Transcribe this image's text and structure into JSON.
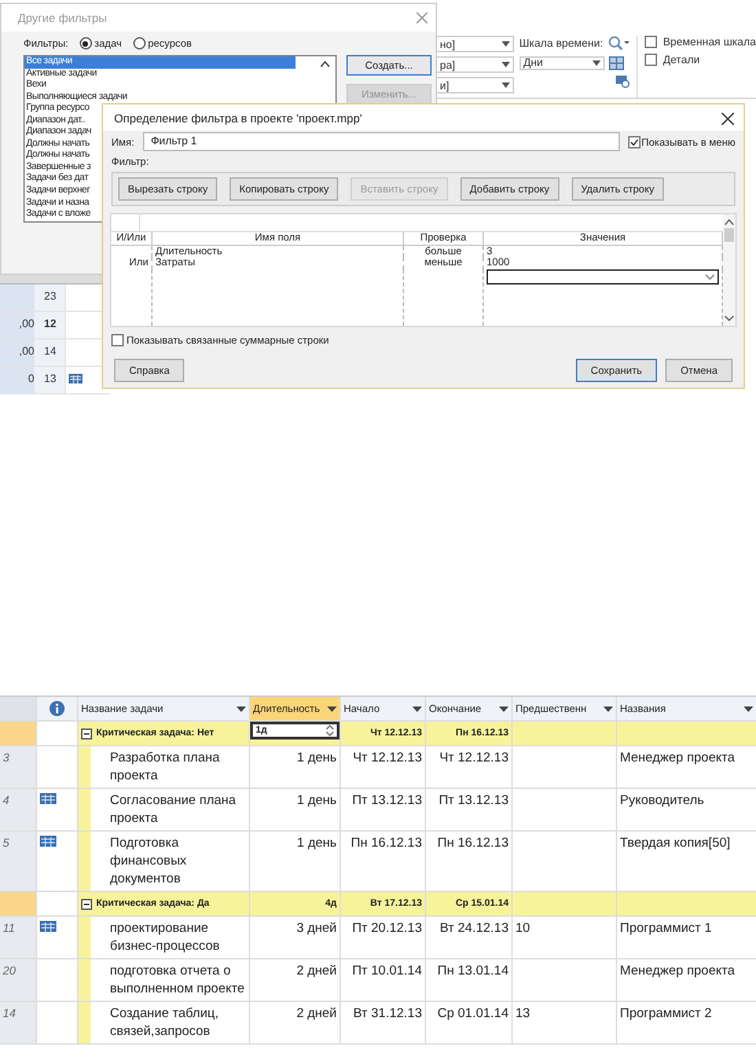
{
  "ribbon": {
    "dropdown_fragments": [
      "но]",
      "ра]",
      "и]"
    ],
    "timescale_label": "Шкала времени:",
    "timescale_value": "Дни",
    "checkboxes": [
      {
        "label": "Временная шкала",
        "checked": false
      },
      {
        "label": "Детали",
        "checked": false
      }
    ]
  },
  "background_table": {
    "rows": [
      {
        "value": "",
        "id": "23",
        "summary": false,
        "indicator": false
      },
      {
        "value": ",00",
        "id": "12",
        "summary": true,
        "indicator": false
      },
      {
        "value": ",00",
        "id": "14",
        "summary": false,
        "indicator": false
      },
      {
        "value": "0",
        "id": "13",
        "summary": false,
        "indicator": true
      }
    ]
  },
  "filters_dialog": {
    "title": "Другие фильтры",
    "filter_label": "Фильтры:",
    "radios": [
      {
        "label": "задач",
        "selected": true
      },
      {
        "label": "ресурсов",
        "selected": false
      }
    ],
    "list": [
      {
        "label": "Все задачи",
        "selected": true
      },
      {
        "label": "Активные задачи",
        "selected": false
      },
      {
        "label": "Вехи",
        "selected": false
      },
      {
        "label": "Выполняющиеся задачи",
        "selected": false
      },
      {
        "label": "Группа ресурсо",
        "selected": false
      },
      {
        "label": "Диапазон дат..",
        "selected": false
      },
      {
        "label": "Диапазон задач",
        "selected": false
      },
      {
        "label": "Должны начать",
        "selected": false
      },
      {
        "label": "Должны начать",
        "selected": false
      },
      {
        "label": "Завершенные з",
        "selected": false
      },
      {
        "label": "Задачи без дат",
        "selected": false
      },
      {
        "label": "Задачи верхнег",
        "selected": false
      },
      {
        "label": "Задачи и назна",
        "selected": false
      },
      {
        "label": "Задачи с вложе",
        "selected": false
      }
    ],
    "buttons": [
      {
        "label": "Создать...",
        "disabled": false
      },
      {
        "label": "Изменить...",
        "disabled": true
      }
    ]
  },
  "filter_dialog": {
    "title": "Определение фильтра в проекте 'проект.mpp'",
    "name_label": "Имя:",
    "name_value": "Фильтр 1",
    "show_in_menu": {
      "label": "Показывать в меню",
      "checked": true
    },
    "filter_label": "Фильтр:",
    "toolbar": [
      {
        "label": "Вырезать строку",
        "disabled": false
      },
      {
        "label": "Копировать строку",
        "disabled": false
      },
      {
        "label": "Вставить строку",
        "disabled": true
      },
      {
        "label": "Добавить строку",
        "disabled": false
      },
      {
        "label": "Удалить строку",
        "disabled": false
      }
    ],
    "columns": [
      "И/Или",
      "Имя поля",
      "Проверка",
      "Значения"
    ],
    "rows": [
      {
        "and_or": "",
        "field": "Длительность",
        "test": "больше",
        "value": "3"
      },
      {
        "and_or": "Или",
        "field": "Затраты",
        "test": "меньше",
        "value": "1000"
      }
    ],
    "new_row_editing": true,
    "show_summary": {
      "label": "Показывать связанные суммарные строки",
      "checked": false
    },
    "buttons": [
      {
        "label": "Справка",
        "kind": "help"
      },
      {
        "label": "Сохранить",
        "kind": "primary"
      },
      {
        "label": "Отмена",
        "kind": "cancel"
      }
    ]
  },
  "gantt_table": {
    "columns": [
      {
        "label": "Название задачи",
        "selected": false
      },
      {
        "label": "Длительность",
        "selected": true
      },
      {
        "label": "Начало",
        "selected": false
      },
      {
        "label": "Окончание",
        "selected": false
      },
      {
        "label": "Предшественн",
        "selected": false
      },
      {
        "label": "Названия",
        "selected": false
      }
    ],
    "rows": [
      {
        "kind": "group",
        "name": "Критическая задача: Нет",
        "duration": "1д",
        "editing": true,
        "start": "Чт 12.12.13",
        "finish": "Пн 16.12.13"
      },
      {
        "kind": "task",
        "id": "3",
        "indicator": false,
        "name": "Разработка плана проекта",
        "duration": "1 день",
        "start": "Чт 12.12.13",
        "finish": "Чт 12.12.13",
        "predecessors": "",
        "resources": "Менеджер проекта"
      },
      {
        "kind": "task",
        "id": "4",
        "indicator": true,
        "name": "Согласование плана проекта",
        "duration": "1 день",
        "start": "Пт 13.12.13",
        "finish": "Пт 13.12.13",
        "predecessors": "",
        "resources": "Руководитель"
      },
      {
        "kind": "task",
        "id": "5",
        "indicator": true,
        "name": "Подготовка финансовых документов",
        "duration": "1 день",
        "start": "Пн 16.12.13",
        "finish": "Пн 16.12.13",
        "predecessors": "",
        "resources": "Твердая копия[50]"
      },
      {
        "kind": "group",
        "name": "Критическая задача: Да",
        "duration": "4д",
        "editing": false,
        "start": "Вт 17.12.13",
        "finish": "Ср 15.01.14"
      },
      {
        "kind": "task",
        "id": "11",
        "indicator": true,
        "name": "проектирование бизнес-процессов",
        "duration": "3 дней",
        "start": "Пт 20.12.13",
        "finish": "Вт 24.12.13",
        "predecessors": "10",
        "resources": "Программист 1"
      },
      {
        "kind": "task",
        "id": "20",
        "indicator": false,
        "name": "подготовка отчета о выполненном проекте",
        "duration": "2 дней",
        "start": "Пт 10.01.14",
        "finish": "Пн 13.01.14",
        "predecessors": "",
        "resources": "Менеджер проекта"
      },
      {
        "kind": "task",
        "id": "14",
        "indicator": false,
        "name": "Создание таблиц, связей,запросов",
        "duration": "2 дней",
        "start": "Вт 31.12.13",
        "finish": "Ср 01.01.14",
        "predecessors": "13",
        "resources": "Программист 2"
      }
    ]
  }
}
